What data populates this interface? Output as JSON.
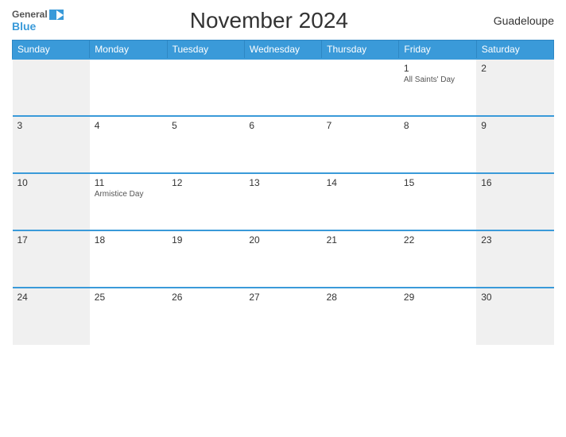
{
  "header": {
    "title": "November 2024",
    "region": "Guadeloupe",
    "logo_general": "General",
    "logo_blue": "Blue"
  },
  "calendar": {
    "days_of_week": [
      "Sunday",
      "Monday",
      "Tuesday",
      "Wednesday",
      "Thursday",
      "Friday",
      "Saturday"
    ],
    "weeks": [
      [
        {
          "day": "",
          "weekend": true
        },
        {
          "day": ""
        },
        {
          "day": ""
        },
        {
          "day": ""
        },
        {
          "day": ""
        },
        {
          "day": "1",
          "event": "All Saints' Day"
        },
        {
          "day": "2",
          "weekend": true
        }
      ],
      [
        {
          "day": "3",
          "weekend": true
        },
        {
          "day": "4"
        },
        {
          "day": "5"
        },
        {
          "day": "6"
        },
        {
          "day": "7"
        },
        {
          "day": "8"
        },
        {
          "day": "9",
          "weekend": true
        }
      ],
      [
        {
          "day": "10",
          "weekend": true
        },
        {
          "day": "11",
          "event": "Armistice Day"
        },
        {
          "day": "12"
        },
        {
          "day": "13"
        },
        {
          "day": "14"
        },
        {
          "day": "15"
        },
        {
          "day": "16",
          "weekend": true
        }
      ],
      [
        {
          "day": "17",
          "weekend": true
        },
        {
          "day": "18"
        },
        {
          "day": "19"
        },
        {
          "day": "20"
        },
        {
          "day": "21"
        },
        {
          "day": "22"
        },
        {
          "day": "23",
          "weekend": true
        }
      ],
      [
        {
          "day": "24",
          "weekend": true
        },
        {
          "day": "25"
        },
        {
          "day": "26"
        },
        {
          "day": "27"
        },
        {
          "day": "28"
        },
        {
          "day": "29"
        },
        {
          "day": "30",
          "weekend": true
        }
      ]
    ]
  }
}
